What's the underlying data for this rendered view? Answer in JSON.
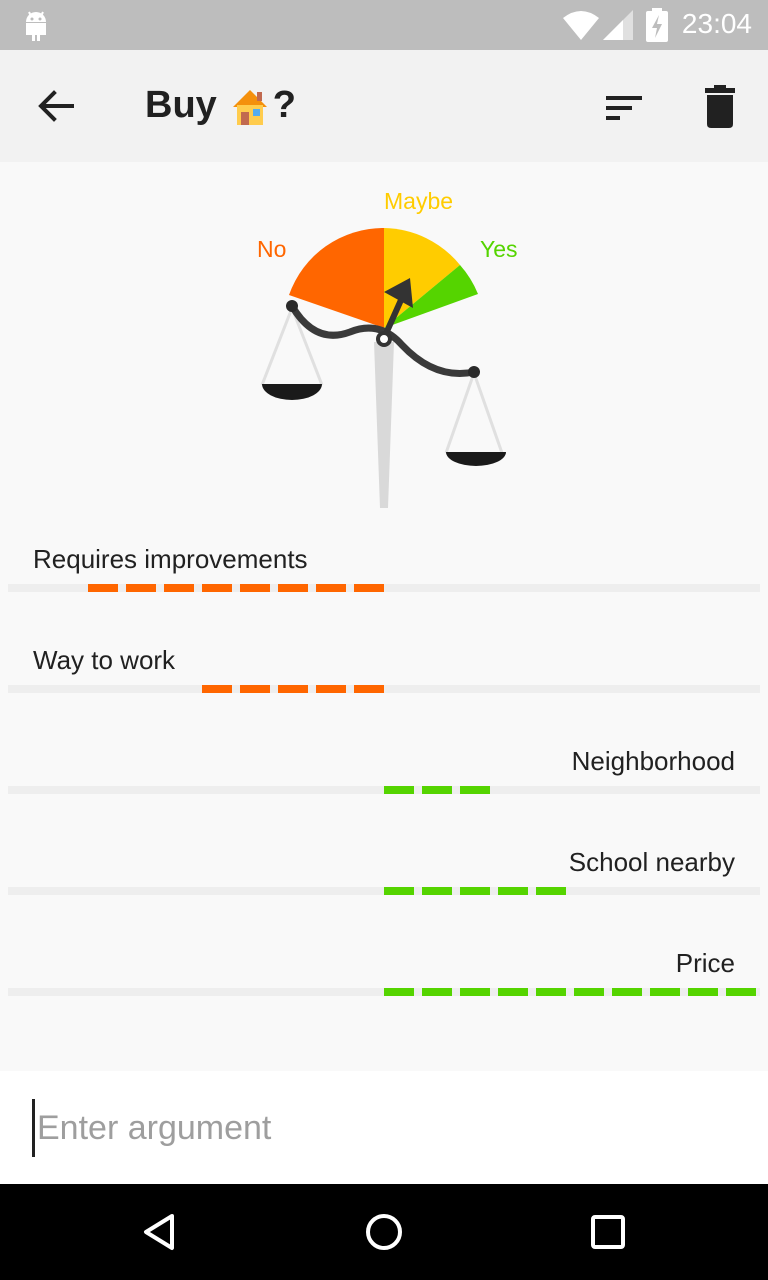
{
  "status_bar": {
    "time": "23:04",
    "icons": [
      "android-icon",
      "wifi-icon",
      "signal-icon",
      "battery-charging-icon"
    ]
  },
  "app_bar": {
    "title_prefix": "Buy",
    "title_suffix": "?",
    "title_emoji": "house-icon",
    "actions": [
      "back-arrow-icon",
      "sort-icon",
      "trash-icon"
    ]
  },
  "verdict": {
    "no_label": "No",
    "maybe_label": "Maybe",
    "yes_label": "Yes",
    "colors": {
      "no": "#ff6600",
      "maybe": "#ffcc00",
      "yes": "#55d400"
    }
  },
  "arguments": [
    {
      "label": "Requires improvements",
      "side": "con",
      "weight": 8
    },
    {
      "label": "Way to work",
      "side": "con",
      "weight": 5
    },
    {
      "label": "Neighborhood",
      "side": "pro",
      "weight": 3
    },
    {
      "label": "School nearby",
      "side": "pro",
      "weight": 5
    },
    {
      "label": "Price",
      "side": "pro",
      "weight": 10
    }
  ],
  "input": {
    "placeholder": "Enter argument"
  },
  "colors": {
    "con": "#ff6600",
    "pro": "#55d400",
    "track": "#eeeeee"
  }
}
